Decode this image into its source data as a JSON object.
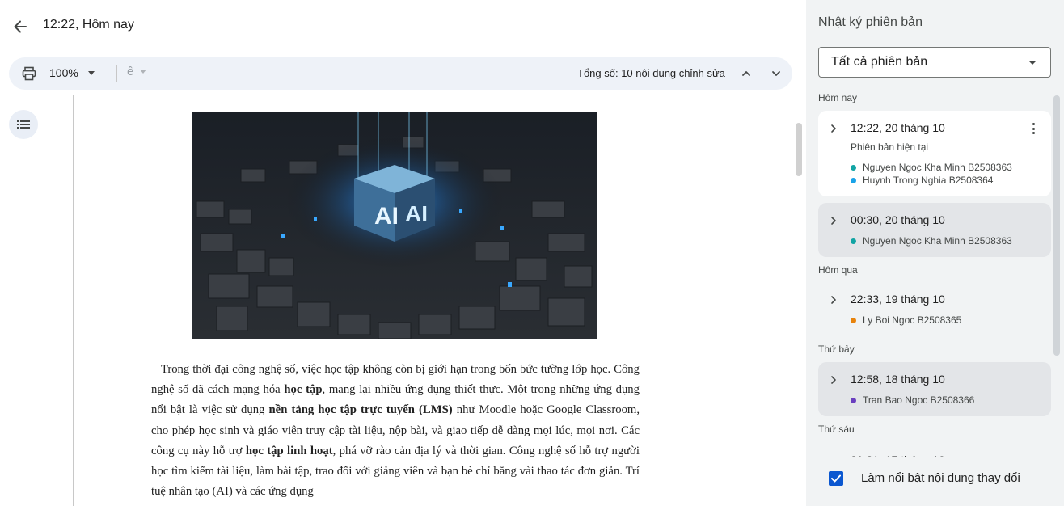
{
  "header": {
    "title": "12:22, Hôm nay"
  },
  "toolbar": {
    "zoom": "100%",
    "special_char": "ê",
    "total_edits": "Tổng số: 10 nội dung chỉnh sửa"
  },
  "document": {
    "image_text": [
      "AI",
      "AI"
    ],
    "paragraph": [
      {
        "text": "Trong thời đại công nghệ số, việc học tập không còn bị giới hạn trong bốn bức tường lớp học. Công nghệ số đã cách mạng hóa ",
        "bold": false
      },
      {
        "text": "học tập",
        "bold": true
      },
      {
        "text": ", mang lại nhiều ứng dụng thiết thực. Một trong những ứng dụng nổi bật là việc sử dụng ",
        "bold": false
      },
      {
        "text": "nền tảng học tập trực tuyến (LMS)",
        "bold": true
      },
      {
        "text": " như Moodle hoặc Google Classroom, cho phép học sinh và giáo viên truy cập tài liệu, nộp bài, và giao tiếp dễ dàng mọi lúc, mọi nơi. Các công cụ này hỗ trợ ",
        "bold": false
      },
      {
        "text": "học tập linh hoạt",
        "bold": true
      },
      {
        "text": ", phá vỡ rào cản địa lý và thời gian. Công nghệ số hỗ trợ người học tìm kiếm tài liệu, làm bài tập, trao đổi với giảng viên và bạn bè chỉ bằng vài thao tác đơn giản. Trí tuệ nhân tạo (AI) và các ứng dụng",
        "bold": false
      }
    ]
  },
  "panel": {
    "title": "Nhật ký phiên bản",
    "filter": "Tất cả phiên bản",
    "groups": [
      {
        "label": "Hôm nay"
      },
      {
        "label": "Hôm qua"
      },
      {
        "label": "Thứ bảy"
      },
      {
        "label": "Thứ sáu"
      }
    ],
    "versions": [
      {
        "time": "12:22, 20 tháng 10",
        "sub": "Phiên bản hiện tại",
        "editors": [
          {
            "name": "Nguyen Ngoc Kha Minh B2508363",
            "color": "#12a4a4"
          },
          {
            "name": "Huynh Trong Nghia B2508364",
            "color": "#1aa3e8"
          }
        ]
      },
      {
        "time": "00:30, 20 tháng 10",
        "editors": [
          {
            "name": "Nguyen Ngoc Kha Minh B2508363",
            "color": "#12a4a4"
          }
        ]
      },
      {
        "time": "22:33, 19 tháng 10",
        "editors": [
          {
            "name": "Ly Boi Ngoc B2508365",
            "color": "#e8830c"
          }
        ]
      },
      {
        "time": "12:58, 18 tháng 10",
        "editors": [
          {
            "name": "Tran Bao Ngoc B2508366",
            "color": "#6a3fbf"
          }
        ]
      },
      {
        "time": "21:21, 17 tháng 10"
      }
    ],
    "highlight_changes": "Làm nổi bật nội dung thay đổi"
  },
  "colors": {
    "accent": "#0b57d0",
    "panel_bg": "#f1f3f4"
  }
}
